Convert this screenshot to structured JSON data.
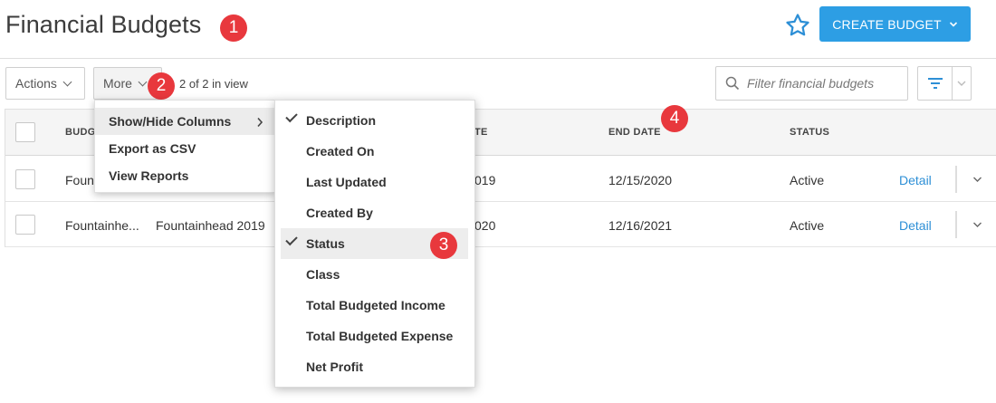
{
  "header": {
    "title": "Financial Budgets",
    "create_button_label": "CREATE BUDGET",
    "badges": [
      "1",
      "2",
      "3",
      "4"
    ]
  },
  "toolbar": {
    "actions_label": "Actions",
    "more_label": "More",
    "in_view_text": "2 of 2 in view",
    "filter_placeholder": "Filter financial budgets"
  },
  "table": {
    "headers": {
      "budget": "BUDG",
      "start_date": "TE",
      "end_date": "END DATE",
      "status": "STATUS"
    },
    "rows": [
      {
        "budget": "Foun",
        "description": "",
        "start_date": "019",
        "end_date": "12/15/2020",
        "status": "Active",
        "action": "Detail"
      },
      {
        "budget": "Fountainhe...",
        "description": "Fountainhead 2019",
        "start_date": "020",
        "end_date": "12/16/2021",
        "status": "Active",
        "action": "Detail"
      }
    ]
  },
  "more_menu": {
    "items": [
      "Show/Hide Columns",
      "Export as CSV",
      "View Reports"
    ]
  },
  "columns_menu": {
    "items": [
      {
        "label": "Description",
        "checked": true
      },
      {
        "label": "Created On",
        "checked": false
      },
      {
        "label": "Last Updated",
        "checked": false
      },
      {
        "label": "Created By",
        "checked": false
      },
      {
        "label": "Status",
        "checked": true
      },
      {
        "label": "Class",
        "checked": false
      },
      {
        "label": "Total Budgeted Income",
        "checked": false
      },
      {
        "label": "Total Budgeted Expense",
        "checked": false
      },
      {
        "label": "Net Profit",
        "checked": false
      }
    ]
  },
  "colors": {
    "accent": "#2d9ee4",
    "badge": "#e8383d",
    "link": "#2d8fd6"
  }
}
